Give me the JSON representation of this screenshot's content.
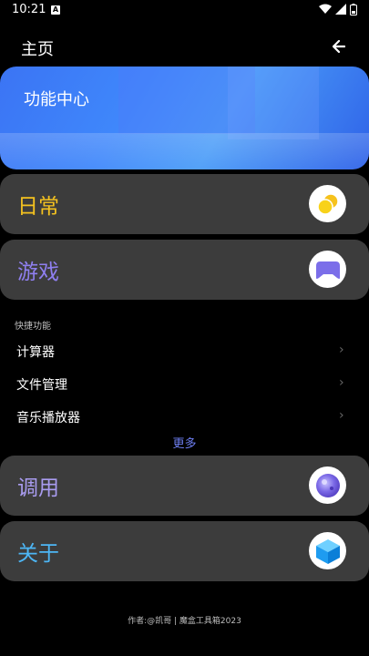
{
  "status_bar": {
    "time": "10:21",
    "sim_indicator": "A",
    "icons": [
      "wifi-icon",
      "signal-icon",
      "battery-icon"
    ]
  },
  "header": {
    "title": "主页",
    "back_icon": "arrow-left-icon"
  },
  "banner": {
    "title": "功能中心",
    "colors": {
      "start": "#3b74f4",
      "end": "#2f62e8"
    }
  },
  "cards": [
    {
      "label": "日常",
      "color": "#f4c21f",
      "icon": "coins-icon"
    },
    {
      "label": "游戏",
      "color": "#8f7ff0",
      "icon": "gamepad-icon"
    },
    {
      "label": "调用",
      "color": "#a99cf0",
      "icon": "orb-icon"
    },
    {
      "label": "关于",
      "color": "#4db6f5",
      "icon": "cube-icon"
    }
  ],
  "quick": {
    "title": "快捷功能",
    "items": [
      {
        "label": "计算器"
      },
      {
        "label": "文件管理"
      },
      {
        "label": "音乐播放器"
      }
    ],
    "more_label": "更多"
  },
  "footer": {
    "text": "作者:@凯哥 | 魔盒工具箱2023"
  },
  "colors": {
    "background": "#000000",
    "card": "#3c3c3c",
    "accent": "#6e7ff2"
  }
}
